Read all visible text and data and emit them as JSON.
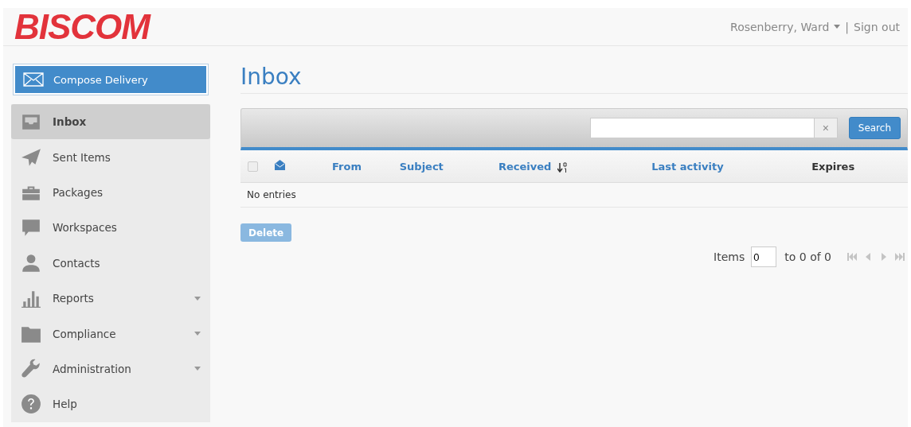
{
  "header": {
    "logo": "BISCOM",
    "user": "Rosenberry, Ward",
    "separator": "|",
    "sign_out": "Sign out"
  },
  "compose": {
    "label": "Compose Delivery"
  },
  "sidebar": {
    "items": [
      {
        "label": "Inbox",
        "kind": "inbox",
        "selected": true,
        "has_submenu": false
      },
      {
        "label": "Sent Items",
        "kind": "plane",
        "selected": false,
        "has_submenu": false
      },
      {
        "label": "Packages",
        "kind": "briefcase",
        "selected": false,
        "has_submenu": false
      },
      {
        "label": "Workspaces",
        "kind": "chat",
        "selected": false,
        "has_submenu": false
      },
      {
        "label": "Contacts",
        "kind": "person",
        "selected": false,
        "has_submenu": false
      },
      {
        "label": "Reports",
        "kind": "bars",
        "selected": false,
        "has_submenu": true
      },
      {
        "label": "Compliance",
        "kind": "folder",
        "selected": false,
        "has_submenu": true
      },
      {
        "label": "Administration",
        "kind": "wrench",
        "selected": false,
        "has_submenu": true
      },
      {
        "label": "Help",
        "kind": "help",
        "selected": false,
        "has_submenu": false
      }
    ]
  },
  "title": "Inbox",
  "search": {
    "clear": "×",
    "button": "Search"
  },
  "table": {
    "columns": [
      {
        "kind": "checkbox",
        "checked": false
      },
      {
        "kind": "icon"
      },
      {
        "kind": "text",
        "label": "From",
        "sortable": true,
        "sorted": false
      },
      {
        "kind": "text",
        "label": "Subject",
        "sortable": true,
        "sorted": false
      },
      {
        "kind": "text",
        "label": "Received",
        "sortable": true,
        "sorted": true
      },
      {
        "kind": "text",
        "label": "Last activity",
        "sortable": true,
        "sorted": false
      },
      {
        "kind": "text",
        "label": "Expires",
        "sortable": false,
        "sorted": false
      }
    ],
    "empty": "No entries"
  },
  "delete": {
    "label": "Delete",
    "disabled": true
  },
  "pager": {
    "label": "Items",
    "value": "0",
    "range": "to 0 of 0",
    "disabled": true
  }
}
